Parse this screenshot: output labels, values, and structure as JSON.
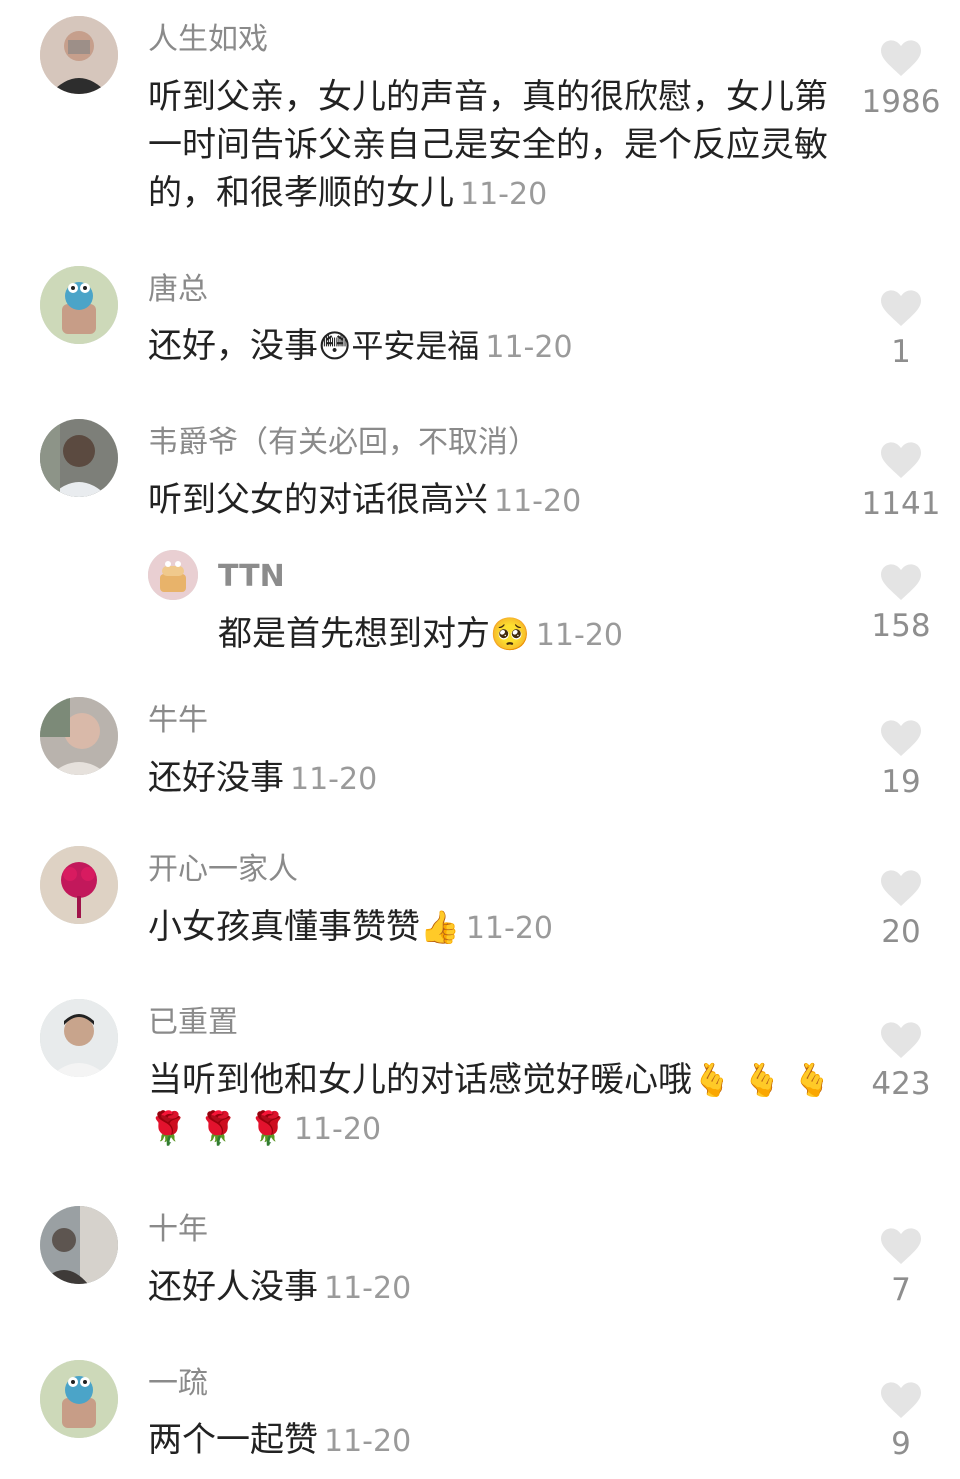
{
  "colors": {
    "text": "#222222",
    "meta": "#8a8a8a",
    "heart": "#e5e5e5"
  },
  "comments": [
    {
      "username": "人生如戏",
      "text": "听到父亲，女儿的声音，真的很欣慰，女儿第一时间告诉父亲自己是安全的，是个反应灵敏的，和很孝顺的女儿",
      "emoji": "",
      "date": "11-20",
      "likes": "1986",
      "avatar_icon": "blurred-person-avatar"
    },
    {
      "username": "唐总",
      "text": "还好，没事",
      "emoji": "😳平安是福",
      "date": "11-20",
      "likes": "1",
      "avatar_icon": "cartoon-mascot-avatar"
    },
    {
      "username": "韦爵爷（有关必回，不取消）",
      "text": "听到父女的对话很高兴",
      "emoji": "",
      "date": "11-20",
      "likes": "1141",
      "avatar_icon": "blurred-person-avatar"
    },
    {
      "username": "TTN",
      "text": "都是首先想到对方",
      "emoji": "🥺",
      "date": "11-20",
      "likes": "158",
      "avatar_icon": "cartoon-cake-avatar",
      "is_reply": true
    },
    {
      "username": "牛牛",
      "text": "还好没事",
      "emoji": "",
      "date": "11-20",
      "likes": "19",
      "avatar_icon": "blurred-person-avatar"
    },
    {
      "username": "开心一家人",
      "text": "小女孩真懂事赞赞",
      "emoji": "👍",
      "date": "11-20",
      "likes": "20",
      "avatar_icon": "rose-avatar"
    },
    {
      "username": "已重置",
      "text": "当听到他和女儿的对话感觉好暖心哦",
      "emoji": "🫰 🫰 🫰 🌹 🌹 🌹",
      "date": "11-20",
      "likes": "423",
      "avatar_icon": "person-photo-avatar"
    },
    {
      "username": "十年",
      "text": "还好人没事",
      "emoji": "",
      "date": "11-20",
      "likes": "7",
      "avatar_icon": "photo-avatar"
    },
    {
      "username": "一疏",
      "text": "两个一起赞",
      "emoji": "",
      "date": "11-20",
      "likes": "9",
      "avatar_icon": "cartoon-mascot-avatar"
    }
  ]
}
